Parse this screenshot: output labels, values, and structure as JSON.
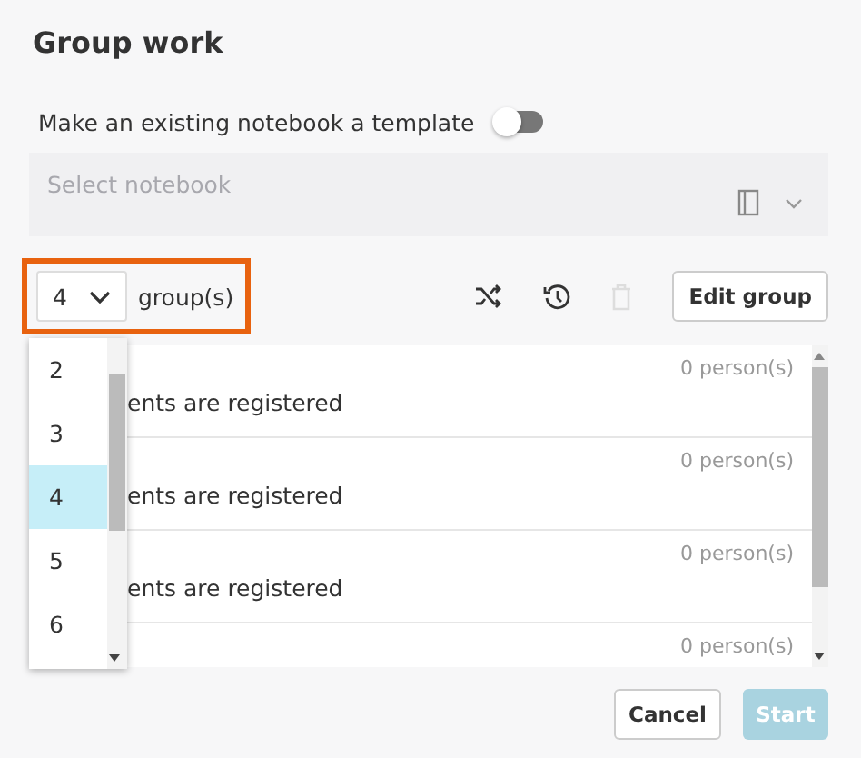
{
  "title": "Group work",
  "template_toggle": {
    "label": "Make an existing notebook a template",
    "on": false
  },
  "notebook_select": {
    "placeholder": "Select notebook",
    "disabled": true
  },
  "group_count": {
    "value": "4",
    "label": "group(s)",
    "highlighted": true
  },
  "toolbar": {
    "delete_disabled": true,
    "edit_button": "Edit group"
  },
  "groups": [
    {
      "message": "ents are registered",
      "count": "0 person(s)"
    },
    {
      "message": "ents are registered",
      "count": "0 person(s)"
    },
    {
      "message": "ents are registered",
      "count": "0 person(s)"
    },
    {
      "count": "0 person(s)"
    }
  ],
  "count_options": [
    {
      "label": "2",
      "selected": false
    },
    {
      "label": "3",
      "selected": false
    },
    {
      "label": "4",
      "selected": true
    },
    {
      "label": "5",
      "selected": false
    },
    {
      "label": "6",
      "selected": false
    }
  ],
  "buttons": {
    "cancel": "Cancel",
    "start": "Start",
    "start_disabled": true
  }
}
